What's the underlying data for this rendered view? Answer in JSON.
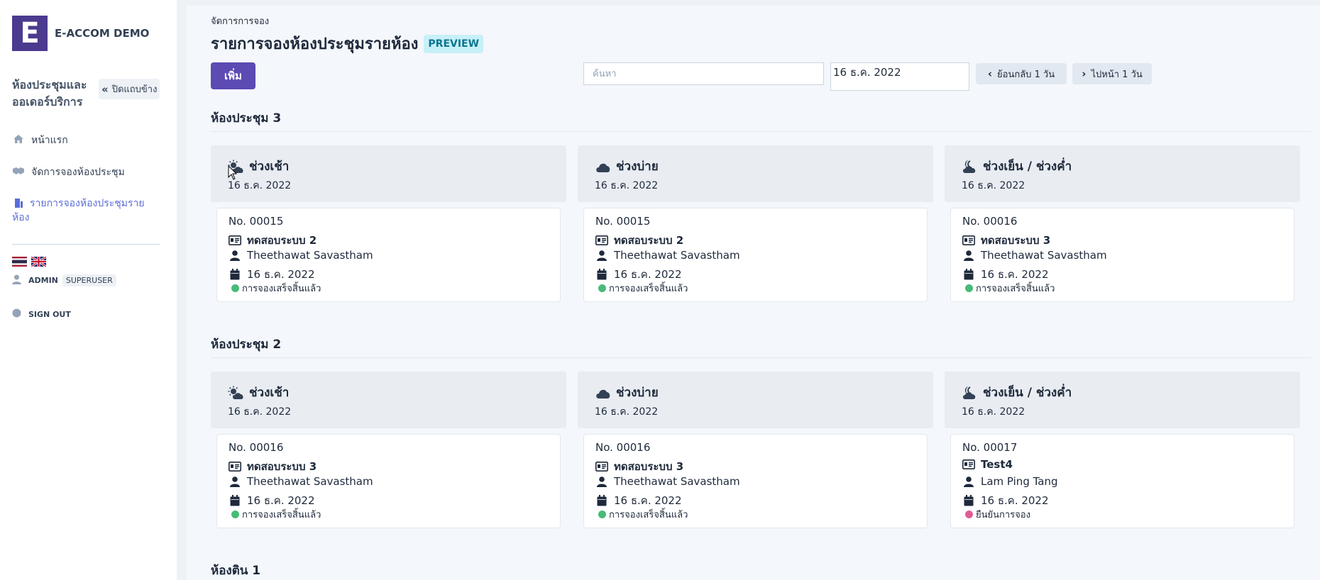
{
  "sidebar": {
    "logo_letter": "E",
    "brand": "E-ACCOM DEMO",
    "module_title": "ห้องประชุมและออเดอร์บริการ",
    "collapse_label": "ปิดแถบข้าง",
    "nav": [
      {
        "label": "หน้าแรก",
        "icon": "home-icon"
      },
      {
        "label": "จัดการจองห้องประชุม",
        "icon": "handshake-icon"
      },
      {
        "label": "รายการจองห้องประชุมรายห้อง",
        "icon": "building-icon"
      }
    ],
    "user_name": "ADMIN",
    "user_role": "SUPERUSER",
    "signout_label": "SIGN OUT"
  },
  "header": {
    "breadcrumb": "จัดการการจอง",
    "title": "รายการจองห้องประชุมรายห้อง",
    "badge": "PREVIEW",
    "add_label": "เพิ่ม",
    "search_placeholder": "ค้นหา",
    "date_value": "16 ธ.ค. 2022",
    "prev_day_label": "ย้อนกลับ 1 วัน",
    "next_day_label": "ไปหน้า 1 วัน"
  },
  "colors": {
    "brand": "#4c3a8f",
    "primary_button": "#5b4bb3",
    "status_complete": "#48bb78",
    "status_confirm": "#e05c96"
  },
  "rooms": [
    {
      "name": "ห้องประชุม 3",
      "slots": [
        {
          "name": "ช่วงเช้า",
          "icon": "sun-cloud-icon",
          "date": "16 ธ.ค. 2022",
          "booking": {
            "no": "No. 00015",
            "title": "ทดสอบระบบ 2",
            "person": "Theethawat Savastham",
            "date": "16 ธ.ค. 2022",
            "status": "การจองเสร็จสิ้นแล้ว",
            "status_color": "#48bb78"
          }
        },
        {
          "name": "ช่วงบ่าย",
          "icon": "cloud-icon",
          "date": "16 ธ.ค. 2022",
          "booking": {
            "no": "No. 00015",
            "title": "ทดสอบระบบ 2",
            "person": "Theethawat Savastham",
            "date": "16 ธ.ค. 2022",
            "status": "การจองเสร็จสิ้นแล้ว",
            "status_color": "#48bb78"
          }
        },
        {
          "name": "ช่วงเย็น / ช่วงค่ำ",
          "icon": "moon-cloud-icon",
          "date": "16 ธ.ค. 2022",
          "booking": {
            "no": "No. 00016",
            "title": "ทดสอบระบบ 3",
            "person": "Theethawat Savastham",
            "date": "16 ธ.ค. 2022",
            "status": "การจองเสร็จสิ้นแล้ว",
            "status_color": "#48bb78"
          }
        }
      ]
    },
    {
      "name": "ห้องประชุม 2",
      "slots": [
        {
          "name": "ช่วงเช้า",
          "icon": "sun-cloud-icon",
          "date": "16 ธ.ค. 2022",
          "booking": {
            "no": "No. 00016",
            "title": "ทดสอบระบบ 3",
            "person": "Theethawat Savastham",
            "date": "16 ธ.ค. 2022",
            "status": "การจองเสร็จสิ้นแล้ว",
            "status_color": "#48bb78"
          }
        },
        {
          "name": "ช่วงบ่าย",
          "icon": "cloud-icon",
          "date": "16 ธ.ค. 2022",
          "booking": {
            "no": "No. 00016",
            "title": "ทดสอบระบบ 3",
            "person": "Theethawat Savastham",
            "date": "16 ธ.ค. 2022",
            "status": "การจองเสร็จสิ้นแล้ว",
            "status_color": "#48bb78"
          }
        },
        {
          "name": "ช่วงเย็น / ช่วงค่ำ",
          "icon": "moon-cloud-icon",
          "date": "16 ธ.ค. 2022",
          "booking": {
            "no": "No. 00017",
            "title": "Test4",
            "person": "Lam Ping Tang",
            "date": "16 ธ.ค. 2022",
            "status": "ยืนยันการจอง",
            "status_color": "#e05c96"
          }
        }
      ]
    },
    {
      "name": "ห้องติน 1",
      "slots": []
    }
  ]
}
